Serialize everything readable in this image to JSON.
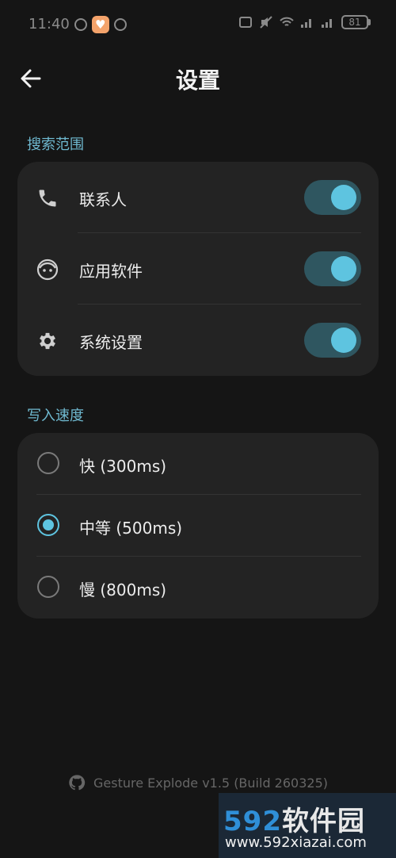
{
  "status_bar": {
    "time": "11:40",
    "battery": "81"
  },
  "header": {
    "title": "设置"
  },
  "search_scope": {
    "section_label": "搜索范围",
    "items": [
      {
        "label": "联系人",
        "icon": "phone-icon",
        "enabled": true
      },
      {
        "label": "应用软件",
        "icon": "android-face-icon",
        "enabled": true
      },
      {
        "label": "系统设置",
        "icon": "gear-icon",
        "enabled": true
      }
    ]
  },
  "write_speed": {
    "section_label": "写入速度",
    "options": [
      {
        "label": "快 (300ms)",
        "selected": false
      },
      {
        "label": "中等 (500ms)",
        "selected": true
      },
      {
        "label": "慢 (800ms)",
        "selected": false
      }
    ]
  },
  "footer": {
    "text": "Gesture Explode v1.5 (Build 260325)"
  },
  "watermark": {
    "brand_num": "592",
    "brand_cn": "软件园",
    "url": "www.592xiazai.com"
  },
  "colors": {
    "accent": "#5ec4e0",
    "toggle_track": "#2f5660",
    "section_label": "#6fb9d0",
    "card_bg": "#232323",
    "page_bg": "#151515"
  }
}
